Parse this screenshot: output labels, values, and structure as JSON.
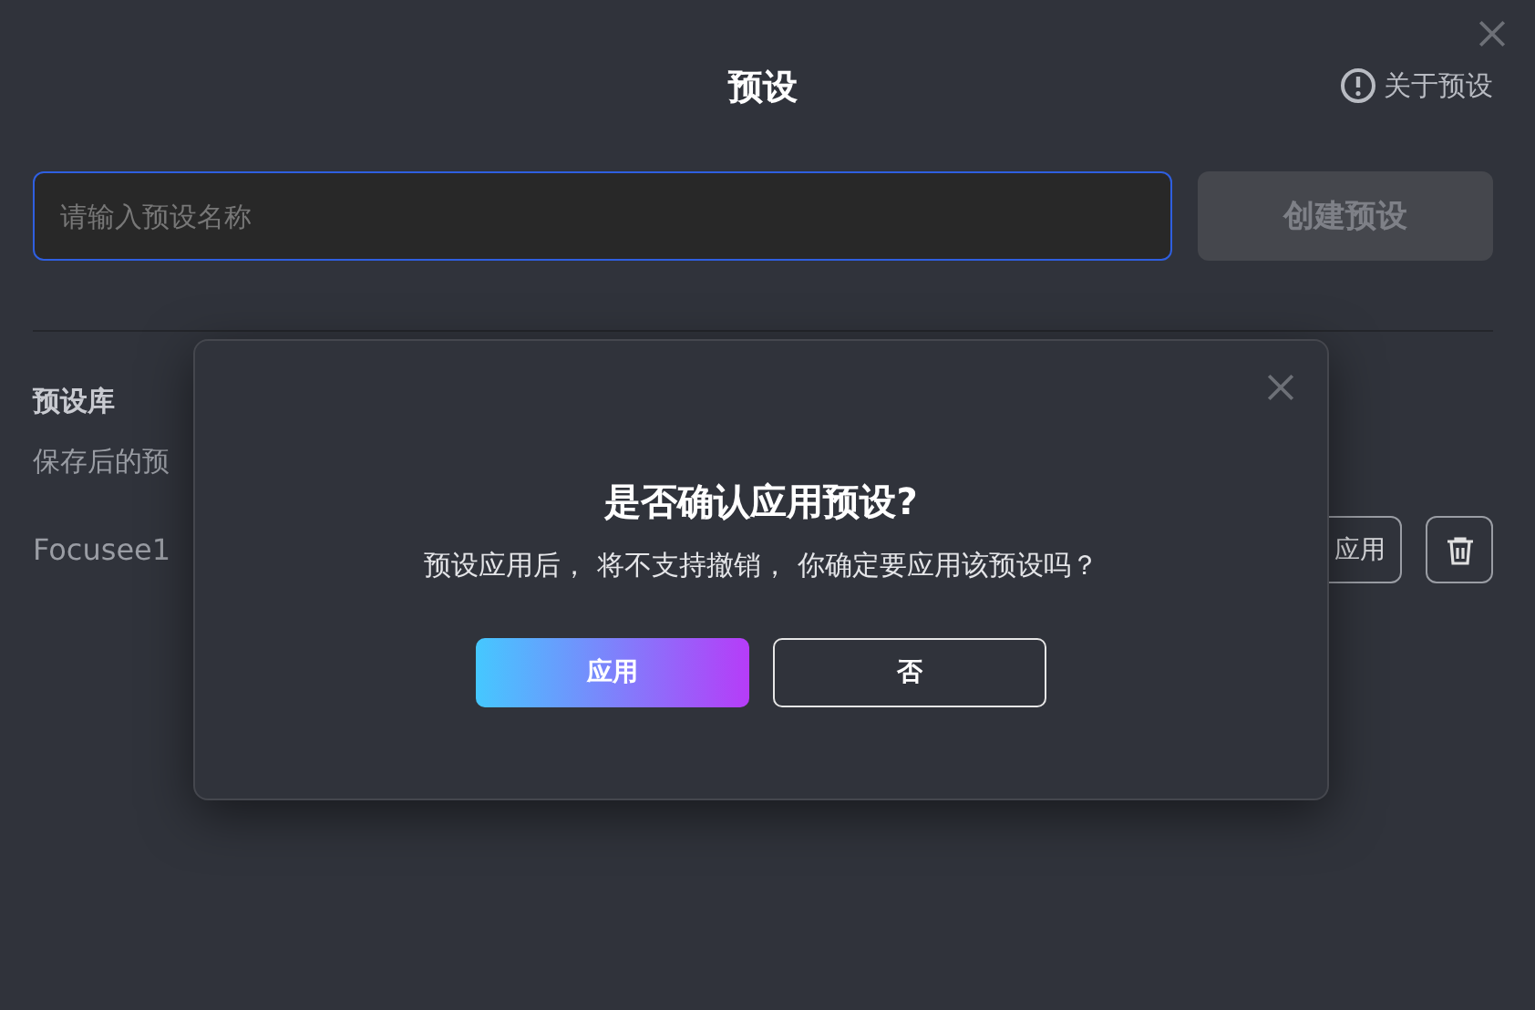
{
  "window": {
    "title": "预设",
    "about_link": "关于预设"
  },
  "name_field": {
    "placeholder": "请输入预设名称",
    "focused": true
  },
  "create_button": {
    "label": "创建预设",
    "disabled": true
  },
  "library": {
    "heading": "预设库",
    "description": "保存后的预",
    "presets": [
      {
        "name": "Focusee1",
        "apply_label": "应用"
      }
    ]
  },
  "confirm_dialog": {
    "title": "是否确认应用预设?",
    "message": "预设应用后， 将不支持撤销， 你确定要应用该预设吗？",
    "buttons": [
      {
        "label": "应用",
        "kind": "primary"
      },
      {
        "label": "否",
        "kind": "secondary"
      }
    ]
  }
}
